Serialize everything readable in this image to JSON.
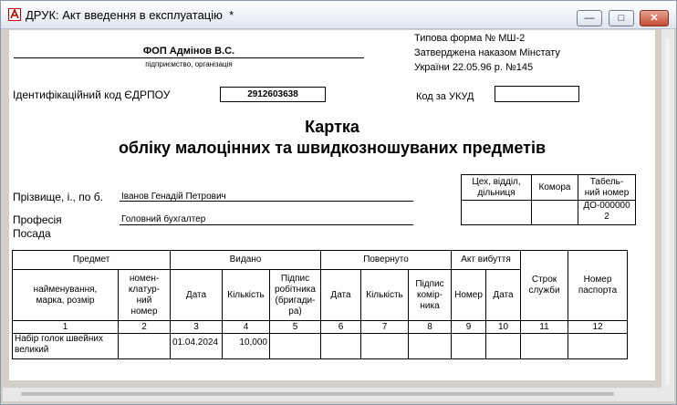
{
  "window": {
    "title": "ДРУК: Акт введення в експлуатацію  *",
    "min_glyph": "—",
    "max_glyph": "□",
    "close_glyph": "✕"
  },
  "form": {
    "org_name": "ФОП Адмінов В.С.",
    "org_caption": "підприємство, організація",
    "form_line1": "Типова форма № МШ-2",
    "form_line2": "Затверджена наказом Мінстату",
    "form_line3": "України 22.05.96 р. №145",
    "edrpou_label": "Ідентифікаційний код ЄДРПОУ",
    "edrpou_value": "2912603638",
    "ukud_label": "Код за УКУД",
    "ukud_value": "",
    "title1": "Картка",
    "title2": "обліку малоцінних та швидкозношуваних предметів",
    "surname_label": "Прізвище, і., по б.",
    "surname_value": "Іванов Генадій Петрович",
    "profession_label": "Професія",
    "position_label": "Посада",
    "profession_value": "Головний бухгалтер"
  },
  "dept_table": {
    "h1": [
      "Цех, відділ,",
      "дільниця"
    ],
    "h2": "Комора",
    "h3": [
      "Табель-",
      "ний номер"
    ],
    "dept_value": "",
    "store_value": "",
    "tab_value": [
      "ДО-000000",
      "2"
    ]
  },
  "main_table": {
    "group_subject": "Предмет",
    "group_issued": "Видано",
    "group_returned": "Повернуто",
    "group_writeoff": "Акт вибуття",
    "col_name": [
      "найменування,",
      "марка, розмір"
    ],
    "col_nomen": [
      "номен-",
      "клатур-",
      "ний",
      "номер"
    ],
    "col_date": "Дата",
    "col_qty": "Кількість",
    "col_sign_worker": [
      "Підпис",
      "робітника",
      "(бригади-",
      "ра)"
    ],
    "col_date2": "Дата",
    "col_qty2": "Кількість",
    "col_sign_store": [
      "Підпис",
      "комір-",
      "ника"
    ],
    "col_num": "Номер",
    "col_date3": "Дата",
    "col_term": [
      "Строк",
      "служби"
    ],
    "col_passport": [
      "Номер",
      "паспорта"
    ],
    "numbers": [
      "1",
      "2",
      "3",
      "4",
      "5",
      "6",
      "7",
      "8",
      "9",
      "10",
      "11",
      "12"
    ],
    "rows": [
      {
        "name": [
          "Набір голок швейних",
          "великий"
        ],
        "nomen": "",
        "date": "01.04.2024",
        "qty": "10,000"
      }
    ]
  }
}
